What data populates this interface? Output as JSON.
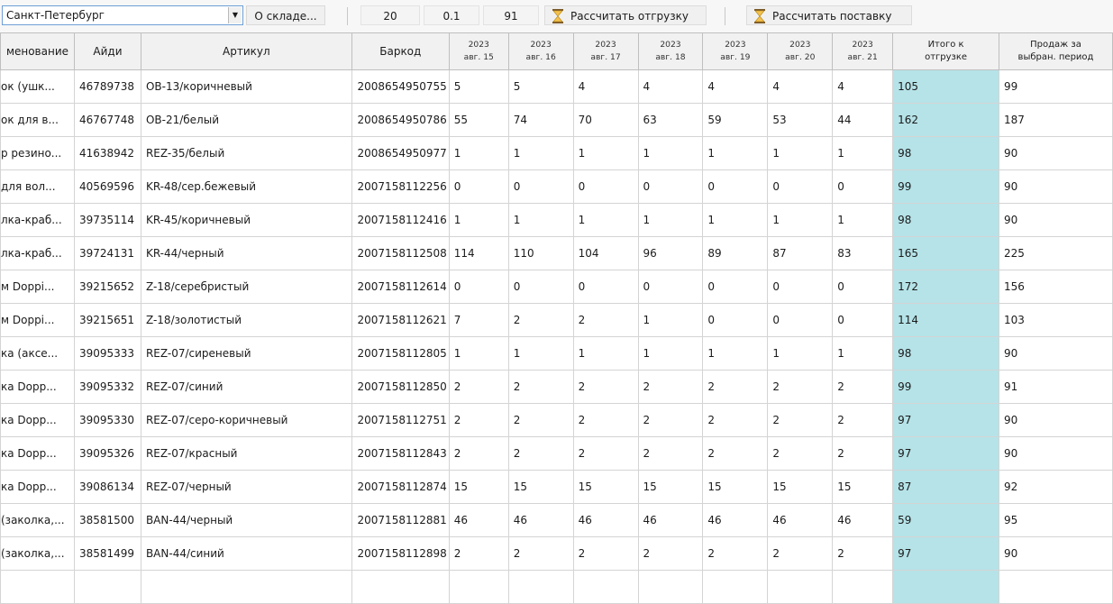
{
  "toolbar": {
    "city": "Санкт-Петербург",
    "about_warehouse": "О складе...",
    "value_1": "20",
    "value_2": "0.1",
    "value_3": "91",
    "calc_shipment": "Рассчитать отгрузку",
    "calc_supply": "Рассчитать поставку"
  },
  "columns": {
    "name": "менование",
    "id": "Айди",
    "article": "Артикул",
    "barcode": "Баркод",
    "dates": [
      {
        "year": "2023",
        "day": "авг. 15"
      },
      {
        "year": "2023",
        "day": "авг. 16"
      },
      {
        "year": "2023",
        "day": "авг. 17"
      },
      {
        "year": "2023",
        "day": "авг. 18"
      },
      {
        "year": "2023",
        "day": "авг. 19"
      },
      {
        "year": "2023",
        "day": "авг. 20"
      },
      {
        "year": "2023",
        "day": "авг. 21"
      }
    ],
    "total_line1": "Итого к",
    "total_line2": "отгрузке",
    "sales_line1": "Продаж за",
    "sales_line2": "выбран. период"
  },
  "rows": [
    {
      "name": "ок (ушк...",
      "id": "46789738",
      "article": "ОВ-13/коричневый",
      "barcode": "2008654950755",
      "days": [
        "5",
        "5",
        "4",
        "4",
        "4",
        "4",
        "4"
      ],
      "total": "105",
      "sales": "99"
    },
    {
      "name": "ок для в...",
      "id": "46767748",
      "article": "ОВ-21/белый",
      "barcode": "2008654950786",
      "days": [
        "55",
        "74",
        "70",
        "63",
        "59",
        "53",
        "44"
      ],
      "total": "162",
      "sales": "187"
    },
    {
      "name": "р резино...",
      "id": "41638942",
      "article": "REZ-35/белый",
      "barcode": "2008654950977",
      "days": [
        "1",
        "1",
        "1",
        "1",
        "1",
        "1",
        "1"
      ],
      "total": "98",
      "sales": "90"
    },
    {
      "name": "для вол...",
      "id": "40569596",
      "article": "KR-48/сер.бежевый",
      "barcode": "2007158112256",
      "days": [
        "0",
        "0",
        "0",
        "0",
        "0",
        "0",
        "0"
      ],
      "total": "99",
      "sales": "90"
    },
    {
      "name": "лка-краб...",
      "id": "39735114",
      "article": "KR-45/коричневый",
      "barcode": "2007158112416",
      "days": [
        "1",
        "1",
        "1",
        "1",
        "1",
        "1",
        "1"
      ],
      "total": "98",
      "sales": "90"
    },
    {
      "name": "лка-краб...",
      "id": "39724131",
      "article": "KR-44/черный",
      "barcode": "2007158112508",
      "days": [
        "114",
        "110",
        "104",
        "96",
        "89",
        "87",
        "83"
      ],
      "total": "165",
      "sales": "225"
    },
    {
      "name": "м Doppi...",
      "id": "39215652",
      "article": "Z-18/серебристый",
      "barcode": "2007158112614",
      "days": [
        "0",
        "0",
        "0",
        "0",
        "0",
        "0",
        "0"
      ],
      "total": "172",
      "sales": "156"
    },
    {
      "name": "м  Doppi...",
      "id": "39215651",
      "article": "Z-18/золотистый",
      "barcode": "2007158112621",
      "days": [
        "7",
        "2",
        "2",
        "1",
        "0",
        "0",
        "0"
      ],
      "total": "114",
      "sales": "103"
    },
    {
      "name": "ка (аксе...",
      "id": "39095333",
      "article": "REZ-07/сиреневый",
      "barcode": "2007158112805",
      "days": [
        "1",
        "1",
        "1",
        "1",
        "1",
        "1",
        "1"
      ],
      "total": "98",
      "sales": "90"
    },
    {
      "name": "ка Dopp...",
      "id": "39095332",
      "article": "REZ-07/синий",
      "barcode": "2007158112850",
      "days": [
        "2",
        "2",
        "2",
        "2",
        "2",
        "2",
        "2"
      ],
      "total": "99",
      "sales": "91"
    },
    {
      "name": "ка Dopp...",
      "id": "39095330",
      "article": "REZ-07/серо-коричневый",
      "barcode": "2007158112751",
      "days": [
        "2",
        "2",
        "2",
        "2",
        "2",
        "2",
        "2"
      ],
      "total": "97",
      "sales": "90"
    },
    {
      "name": "ка Dopp...",
      "id": "39095326",
      "article": "REZ-07/красный",
      "barcode": "2007158112843",
      "days": [
        "2",
        "2",
        "2",
        "2",
        "2",
        "2",
        "2"
      ],
      "total": "97",
      "sales": "90"
    },
    {
      "name": "ка Dopp...",
      "id": "39086134",
      "article": "REZ-07/черный",
      "barcode": "2007158112874",
      "days": [
        "15",
        "15",
        "15",
        "15",
        "15",
        "15",
        "15"
      ],
      "total": "87",
      "sales": "92"
    },
    {
      "name": "(заколка,...",
      "id": "38581500",
      "article": "BAN-44/черный",
      "barcode": "2007158112881",
      "days": [
        "46",
        "46",
        "46",
        "46",
        "46",
        "46",
        "46"
      ],
      "total": "59",
      "sales": "95"
    },
    {
      "name": "(заколка,...",
      "id": "38581499",
      "article": "BAN-44/синий",
      "barcode": "2007158112898",
      "days": [
        "2",
        "2",
        "2",
        "2",
        "2",
        "2",
        "2"
      ],
      "total": "97",
      "sales": "90"
    },
    {
      "name": "",
      "id": "",
      "article": "",
      "barcode": "",
      "days": [
        "",
        "",
        "",
        "",
        "",
        "",
        ""
      ],
      "total": "",
      "sales": ""
    }
  ]
}
